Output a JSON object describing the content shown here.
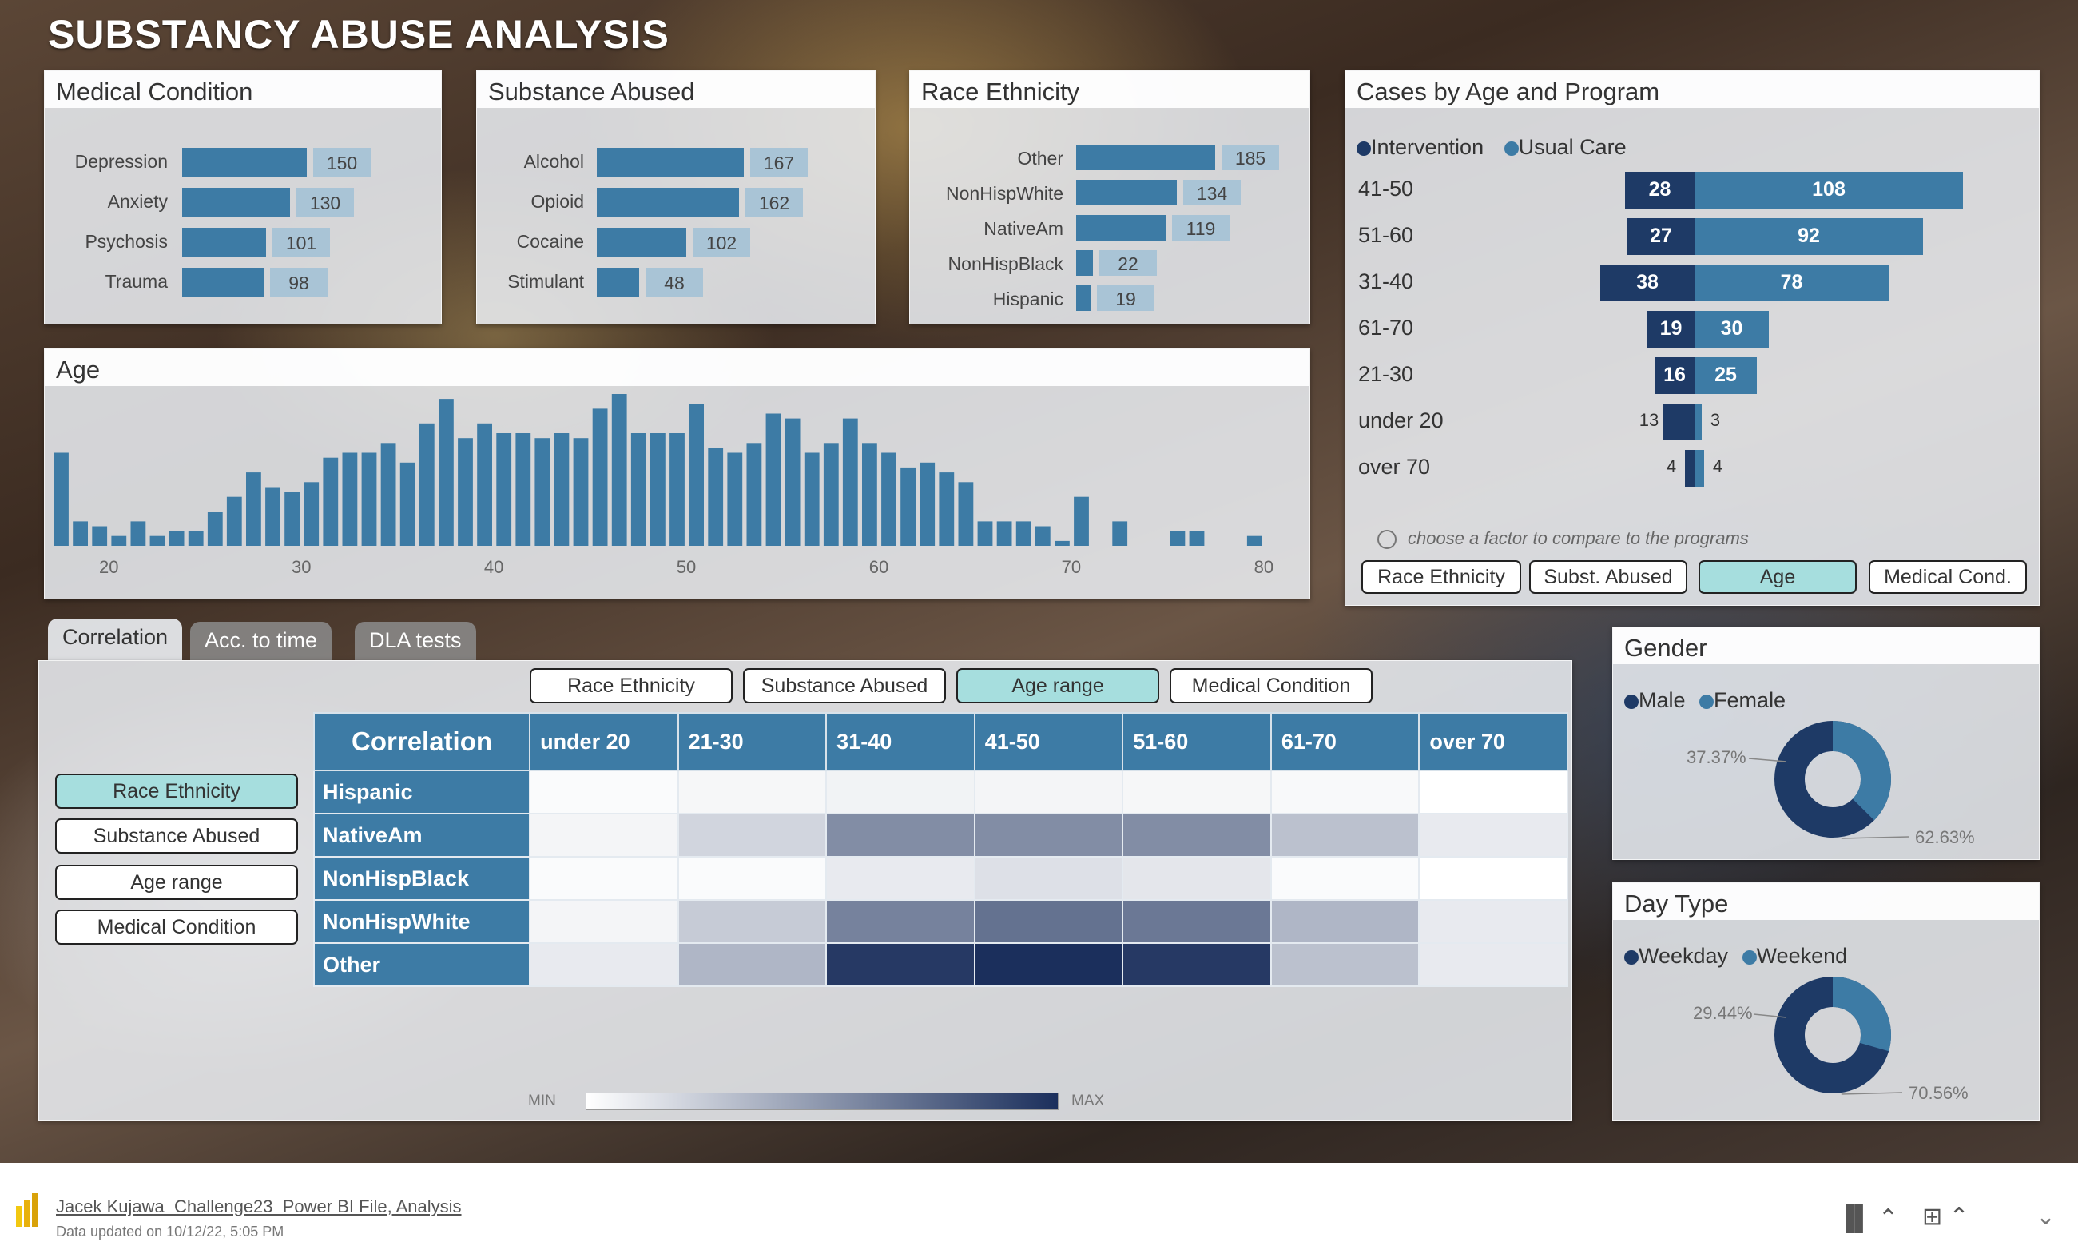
{
  "title": "SUBSTANCY ABUSE ANALYSIS",
  "colors": {
    "bar": "#3d7ba5",
    "value_bg": "#a9c4d6",
    "intervention": "#1e3a66",
    "usual_care": "#3d7ba5",
    "toggle_active": "#a6dede"
  },
  "medical": {
    "title": "Medical Condition",
    "items": [
      {
        "label": "Depression",
        "value": "150"
      },
      {
        "label": "Anxiety",
        "value": "130"
      },
      {
        "label": "Psychosis",
        "value": "101"
      },
      {
        "label": "Trauma",
        "value": "98"
      }
    ]
  },
  "substance": {
    "title": "Substance Abused",
    "items": [
      {
        "label": "Alcohol",
        "value": "167"
      },
      {
        "label": "Opioid",
        "value": "162"
      },
      {
        "label": "Cocaine",
        "value": "102"
      },
      {
        "label": "Stimulant",
        "value": "48"
      }
    ]
  },
  "race": {
    "title": "Race Ethnicity",
    "items": [
      {
        "label": "Other",
        "value": "185"
      },
      {
        "label": "NonHispWhite",
        "value": "134"
      },
      {
        "label": "NativeAm",
        "value": "119"
      },
      {
        "label": "NonHispBlack",
        "value": "22"
      },
      {
        "label": "Hispanic",
        "value": "19"
      }
    ]
  },
  "cases": {
    "title": "Cases by Age and Program",
    "legend": [
      "Intervention",
      "Usual Care"
    ],
    "rows": [
      {
        "label": "41-50",
        "intervention": "28",
        "usual": "108"
      },
      {
        "label": "51-60",
        "intervention": "27",
        "usual": "92"
      },
      {
        "label": "31-40",
        "intervention": "38",
        "usual": "78"
      },
      {
        "label": "61-70",
        "intervention": "19",
        "usual": "30"
      },
      {
        "label": "21-30",
        "intervention": "16",
        "usual": "25"
      },
      {
        "label": "under 20",
        "intervention": "13",
        "usual": "3"
      },
      {
        "label": "over 70",
        "intervention": "4",
        "usual": "4"
      }
    ],
    "hint": "choose a factor to compare to the programs",
    "buttons": [
      "Race Ethnicity",
      "Subst. Abused",
      "Age",
      "Medical Cond."
    ],
    "active": "Age"
  },
  "age": {
    "title": "Age",
    "ticks": [
      "20",
      "30",
      "40",
      "50",
      "60",
      "70",
      "80"
    ]
  },
  "chart_data": {
    "type": "bar",
    "title": "Age",
    "xlim": [
      18,
      82
    ],
    "x": [
      18,
      19,
      20,
      21,
      22,
      23,
      24,
      25,
      26,
      27,
      28,
      29,
      30,
      31,
      32,
      33,
      34,
      35,
      36,
      37,
      38,
      39,
      40,
      41,
      42,
      43,
      44,
      45,
      46,
      47,
      48,
      49,
      50,
      51,
      52,
      53,
      54,
      55,
      56,
      57,
      58,
      59,
      60,
      61,
      62,
      63,
      64,
      65,
      66,
      67,
      68,
      69,
      70,
      71,
      72,
      73,
      74,
      75,
      76,
      77,
      78,
      79,
      80
    ],
    "values": [
      19,
      5,
      4,
      2,
      5,
      2,
      3,
      3,
      7,
      10,
      15,
      12,
      11,
      13,
      18,
      19,
      19,
      21,
      17,
      25,
      30,
      22,
      25,
      23,
      23,
      22,
      23,
      22,
      28,
      31,
      23,
      23,
      23,
      29,
      20,
      19,
      21,
      27,
      26,
      19,
      21,
      26,
      21,
      19,
      16,
      17,
      15,
      13,
      5,
      5,
      5,
      4,
      1,
      10,
      0,
      5,
      0,
      0,
      3,
      3,
      0,
      0,
      2
    ]
  },
  "tabs": [
    "Correlation",
    "Acc. to time",
    "DLA tests"
  ],
  "corr": {
    "top_buttons": [
      "Race Ethnicity",
      "Substance Abused",
      "Age range",
      "Medical Condition"
    ],
    "top_active": "Age range",
    "side_buttons": [
      "Race Ethnicity",
      "Substance Abused",
      "Age range",
      "Medical Condition"
    ],
    "side_active": "Race Ethnicity",
    "corner": "Correlation",
    "columns": [
      "under 20",
      "21-30",
      "31-40",
      "41-50",
      "51-60",
      "61-70",
      "over 70"
    ],
    "rows": [
      {
        "label": "Hispanic",
        "values": [
          0.02,
          0.04,
          0.06,
          0.05,
          0.04,
          0.03,
          0.0
        ]
      },
      {
        "label": "NativeAm",
        "values": [
          0.05,
          0.2,
          0.55,
          0.55,
          0.55,
          0.3,
          0.1
        ]
      },
      {
        "label": "NonHispBlack",
        "values": [
          0.02,
          0.02,
          0.1,
          0.15,
          0.12,
          0.02,
          0.0
        ]
      },
      {
        "label": "NonHispWhite",
        "values": [
          0.05,
          0.25,
          0.6,
          0.68,
          0.65,
          0.35,
          0.1
        ]
      },
      {
        "label": "Other",
        "values": [
          0.1,
          0.35,
          0.95,
          1.0,
          0.95,
          0.3,
          0.1
        ]
      }
    ],
    "min_label": "MIN",
    "max_label": "MAX"
  },
  "gender": {
    "title": "Gender",
    "legend": [
      "Male",
      "Female"
    ],
    "male_pct": "62.63%",
    "female_pct": "37.37%",
    "male": 62.63,
    "female": 37.37
  },
  "daytype": {
    "title": "Day Type",
    "legend": [
      "Weekday",
      "Weekend"
    ],
    "weekday_pct": "70.56%",
    "weekend_pct": "29.44%",
    "weekday": 70.56,
    "weekend": 29.44
  },
  "footer": {
    "file": "Jacek Kujawa_Challenge23_Power BI File, Analysis",
    "updated": "Data updated on 10/12/22, 5:05 PM"
  }
}
